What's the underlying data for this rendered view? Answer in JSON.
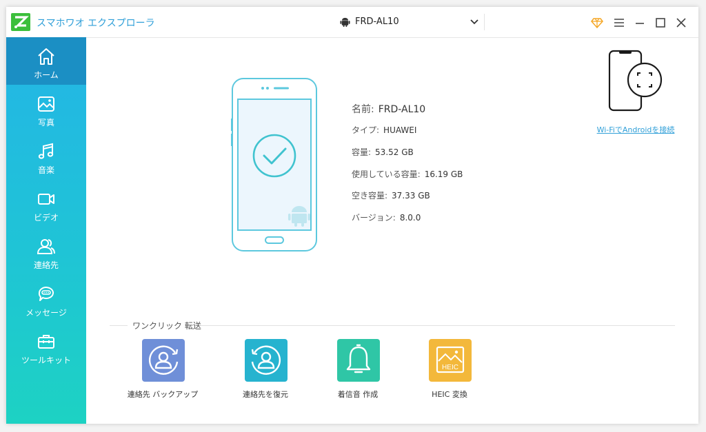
{
  "app": {
    "title": "スマホワオ エクスプローラ"
  },
  "device": {
    "selected": "FRD-AL10"
  },
  "colors": {
    "accent": "#2f9fd8",
    "sidebar_top": "#24b5e6",
    "sidebar_bottom": "#1dd2c3",
    "sidebar_active": "#1b8fc4",
    "premium": "#f5a623"
  },
  "titlebar_icons": [
    "diamond-icon",
    "menu-icon",
    "minimize-icon",
    "maximize-icon",
    "close-icon"
  ],
  "sidebar": {
    "items": [
      {
        "label": "ホーム",
        "icon": "home-icon",
        "active": true
      },
      {
        "label": "写真",
        "icon": "photo-icon"
      },
      {
        "label": "音楽",
        "icon": "music-icon"
      },
      {
        "label": "ビデオ",
        "icon": "video-icon"
      },
      {
        "label": "連絡先",
        "icon": "contacts-icon"
      },
      {
        "label": "メッセージ",
        "icon": "message-icon"
      },
      {
        "label": "ツールキット",
        "icon": "toolkit-icon"
      }
    ]
  },
  "info": {
    "name_label": "名前:",
    "name_value": "FRD-AL10",
    "type_label": "タイプ:",
    "type_value": "HUAWEI",
    "capacity_label": "容量:",
    "capacity_value": "53.52 GB",
    "used_label": "使用している容量:",
    "used_value": "16.19 GB",
    "free_label": "空き容量:",
    "free_value": "37.33 GB",
    "version_label": "バージョン:",
    "version_value": "8.0.0"
  },
  "wifi": {
    "link": "Wi-FiでAndroidを接続"
  },
  "quick": {
    "title": "ワンクリック 転送",
    "tools": [
      {
        "label": "連絡先 バックアップ",
        "color": "#6f8fd8",
        "icon": "contact-backup-icon"
      },
      {
        "label": "連絡先を復元",
        "color": "#26b3cf",
        "icon": "contact-restore-icon"
      },
      {
        "label": "着信音 作成",
        "color": "#2fc6a6",
        "icon": "ringtone-icon"
      },
      {
        "label": "HEIC 変換",
        "color": "#f3b83b",
        "icon": "heic-icon",
        "badge": "HEIC"
      }
    ]
  }
}
